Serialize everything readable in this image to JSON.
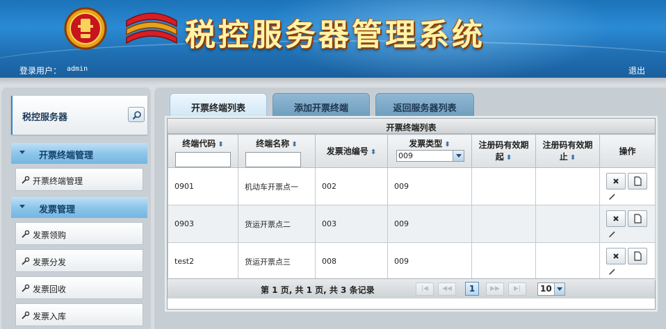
{
  "header": {
    "title": "税控服务器管理系统",
    "user_label": "登录用户：",
    "user_name": "admin",
    "logout_label": "退出"
  },
  "sidebar": {
    "title": "税控服务器",
    "groups": [
      {
        "label": "开票终端管理",
        "items": [
          {
            "label": "开票终端管理"
          }
        ]
      },
      {
        "label": "发票管理",
        "items": [
          {
            "label": "发票领购"
          },
          {
            "label": "发票分发"
          },
          {
            "label": "发票回收"
          },
          {
            "label": "发票入库"
          }
        ]
      }
    ]
  },
  "tabs": [
    {
      "label": "开票终端列表",
      "active": true
    },
    {
      "label": "添加开票终端",
      "active": false
    },
    {
      "label": "返回服务器列表",
      "active": false
    }
  ],
  "grid": {
    "title": "开票终端列表",
    "columns": [
      {
        "label": "终端代码",
        "sortable": true,
        "filter": "input"
      },
      {
        "label": "终端名称",
        "sortable": true,
        "filter": "input"
      },
      {
        "label": "发票池编号",
        "sortable": true
      },
      {
        "label": "发票类型",
        "sortable": true,
        "filter": "select"
      },
      {
        "label": "注册码有效期起",
        "sortable": true
      },
      {
        "label": "注册码有效期止",
        "sortable": true
      },
      {
        "label": "操作"
      }
    ],
    "filters": {
      "terminal_code": "",
      "terminal_name": "",
      "invoice_type_selected": "009"
    },
    "rows": [
      {
        "code": "0901",
        "name": "机动车开票点一",
        "pool": "002",
        "type": "009",
        "valid_from": "",
        "valid_to": ""
      },
      {
        "code": "0903",
        "name": "货运开票点二",
        "pool": "003",
        "type": "009",
        "valid_from": "",
        "valid_to": ""
      },
      {
        "code": "test2",
        "name": "货运开票点三",
        "pool": "008",
        "type": "009",
        "valid_from": "",
        "valid_to": ""
      }
    ]
  },
  "pager": {
    "info": "第 1 页, 共 1 页, 共 3 条记录",
    "current_page": "1",
    "page_size": "10"
  },
  "icons": {
    "search": "search-icon",
    "delete": "delete-icon",
    "view": "document-icon",
    "edit": "pencil-icon",
    "wrench": "wrench-icon"
  },
  "colors": {
    "header_blue": "#1f6fb2",
    "title_gold": "#fff3a8",
    "group_header": "#8cc6ea"
  }
}
